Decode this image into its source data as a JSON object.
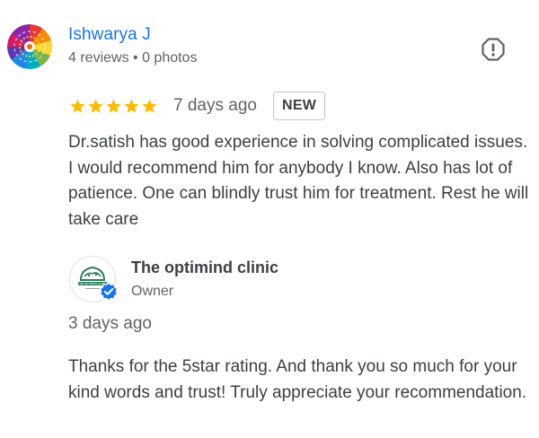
{
  "review": {
    "reviewer_name": "Ishwarya J",
    "reviewer_meta": "4 reviews • 0 photos",
    "rating": 5,
    "max_rating": 5,
    "time": "7 days ago",
    "badge": "NEW",
    "text": "Dr.satish has good experience in solving complicated issues. I would recommend him for anybody I know. Also has lot of patience. One can blindly trust him for treatment. Rest he will take care",
    "star_color": "#fbbc04",
    "report_icon": "report-flag-icon"
  },
  "owner_reply": {
    "owner_name": "The optimind clinic",
    "owner_role": "Owner",
    "logo_text": "THE OPTIMIND CLINIC",
    "time": "3 days ago",
    "text": "Thanks for the 5star rating. And thank you so much for your kind words and trust! Truly appreciate your recommendation.",
    "verified_color": "#1a73e8",
    "logo_color": "#2e7d5b"
  }
}
